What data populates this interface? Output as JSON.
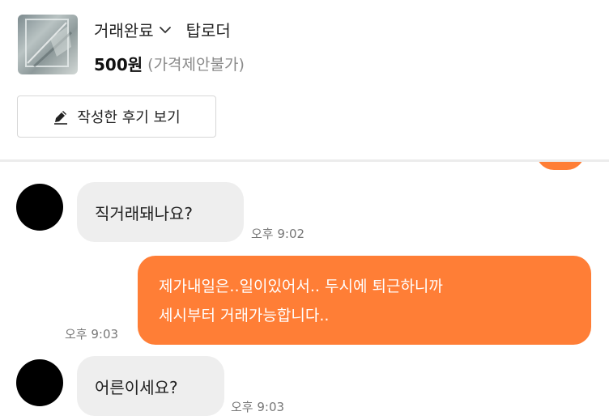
{
  "product": {
    "status": "거래완료",
    "title": "탑로더",
    "price": "500원",
    "price_note": "(가격제안불가)",
    "review_button_label": "작성한 후기 보기"
  },
  "icons": {
    "status_chevron": "chevron-down-icon",
    "review_button": "pencil-icon"
  },
  "colors": {
    "outgoing_bubble": "#ff7e36",
    "incoming_bubble": "#eeeeee"
  },
  "chat": {
    "messages": [
      {
        "direction": "incoming",
        "text": "직거래돼나요?",
        "time": "오후 9:02"
      },
      {
        "direction": "outgoing",
        "line1": "제가내일은..일이있어서.. 두시에 퇴근하니까",
        "line2": "세시부터 거래가능합니다..",
        "time": "오후 9:03"
      },
      {
        "direction": "incoming",
        "text": "어른이세요?",
        "time": "오후 9:03"
      }
    ]
  }
}
